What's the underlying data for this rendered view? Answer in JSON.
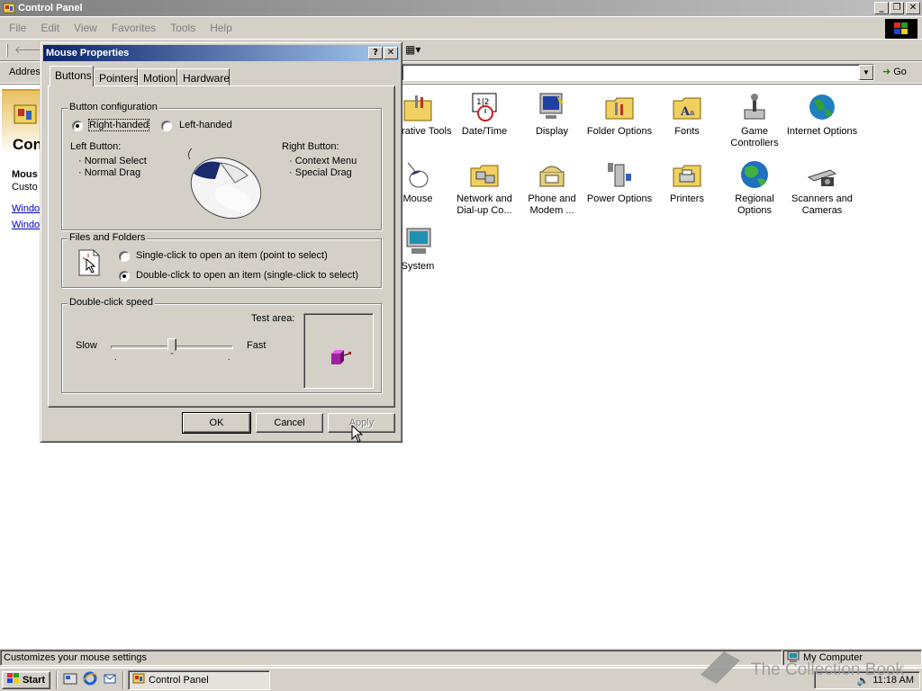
{
  "main_window": {
    "title": "Control Panel",
    "menu": [
      "File",
      "Edit",
      "View",
      "Favorites",
      "Tools",
      "Help"
    ],
    "toolbar_back": "Ba",
    "address_label": "Addres",
    "go_label": "Go",
    "left_panel": {
      "title": "Con",
      "heading": "Mous",
      "subtext": "Custo",
      "links": [
        "Windo",
        "Windo"
      ]
    }
  },
  "control_panel_items": [
    {
      "label": "inistrative Tools",
      "icon": "administrative-tools-icon"
    },
    {
      "label": "Date/Time",
      "icon": "date-time-icon"
    },
    {
      "label": "Display",
      "icon": "display-icon"
    },
    {
      "label": "Folder Options",
      "icon": "folder-options-icon"
    },
    {
      "label": "Fonts",
      "icon": "fonts-icon"
    },
    {
      "label": "Game Controllers",
      "icon": "game-controllers-icon"
    },
    {
      "label": "Internet Options",
      "icon": "internet-options-icon"
    },
    {
      "label": "Mouse",
      "icon": "mouse-icon"
    },
    {
      "label": "Network and Dial-up Co...",
      "icon": "network-icon"
    },
    {
      "label": "Phone and Modem ...",
      "icon": "phone-modem-icon"
    },
    {
      "label": "Power Options",
      "icon": "power-options-icon"
    },
    {
      "label": "Printers",
      "icon": "printers-icon"
    },
    {
      "label": "Regional Options",
      "icon": "regional-options-icon"
    },
    {
      "label": "Scanners and Cameras",
      "icon": "scanners-cameras-icon"
    },
    {
      "label": "System",
      "icon": "system-icon"
    }
  ],
  "dialog": {
    "title": "Mouse Properties",
    "tabs": [
      "Buttons",
      "Pointers",
      "Motion",
      "Hardware"
    ],
    "button_config": {
      "label": "Button configuration",
      "right_handed": "Right-handed",
      "left_handed": "Left-handed",
      "left_button_label": "Left Button:",
      "left_button_items": [
        "Normal Select",
        "Normal Drag"
      ],
      "right_button_label": "Right Button:",
      "right_button_items": [
        "Context Menu",
        "Special Drag"
      ]
    },
    "files_folders": {
      "label": "Files and Folders",
      "single_click": "Single-click to open an item (point to select)",
      "double_click": "Double-click to open an item (single-click to select)"
    },
    "double_click_speed": {
      "label": "Double-click speed",
      "slow": "Slow",
      "fast": "Fast",
      "test_area": "Test area:",
      "slider_value": 0.5
    },
    "buttons": {
      "ok": "OK",
      "cancel": "Cancel",
      "apply": "Apply"
    }
  },
  "status_bar": {
    "left_text": "Customizes your mouse settings",
    "right_text": "My Computer"
  },
  "taskbar": {
    "start": "Start",
    "task": "Control Panel",
    "clock": "11:18 AM"
  },
  "watermark": "The Collection Book"
}
